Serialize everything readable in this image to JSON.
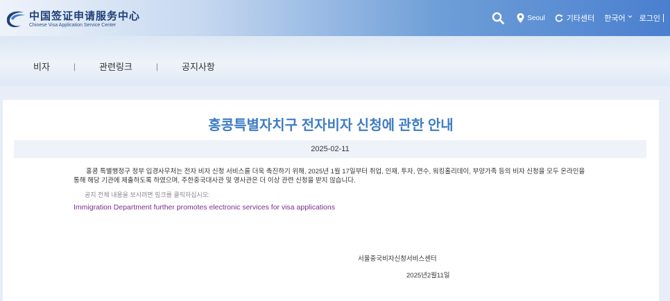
{
  "header": {
    "logo_cn": "中国签证申请服务中心",
    "logo_en": "Chinese Visa Application Service Center",
    "location": "Seoul",
    "other_centers": "기타센터",
    "language": "한국어",
    "login": "로그인"
  },
  "nav": {
    "items": [
      {
        "label": "비자"
      },
      {
        "label": "관련링크"
      },
      {
        "label": "공지사항"
      }
    ],
    "separator": "|"
  },
  "notice": {
    "title": "홍콩특별자치구 전자비자 신청에 관한 안내",
    "date": "2025-02-11",
    "body": "홍콩 특별행정구 정부 입경사무처는 전자 비자 신청 서비스를 더욱 촉진하기 위해, 2025년 1월 17일부터 취업, 인재, 투자, 연수, 워킹홀리데이, 부양가족 등의 비자 신청을 모두 온라인을 통해 해당 기관에 제출하도록 하였으며, 주한중국대사관 및 영사관은 더 이상 관련 신청을 받지 않습니다.",
    "hint": "공지 전체 내용을 보시려면 링크를 클릭하십시오:",
    "link_text": "Immigration Department further promotes electronic services for visa applications",
    "signature_org": "서울중국비자신청서비스센터",
    "signature_date": "2025년2월11일"
  },
  "icons": {
    "search": "search-icon",
    "location": "location-pin-icon",
    "refresh": "refresh-icon",
    "dropdown": "chevron-down-icon",
    "logo": "logo-mark-icon"
  },
  "colors": {
    "title": "#3d7cc5",
    "link": "#7b2c8e",
    "header_blue": "#4a7fcf"
  }
}
